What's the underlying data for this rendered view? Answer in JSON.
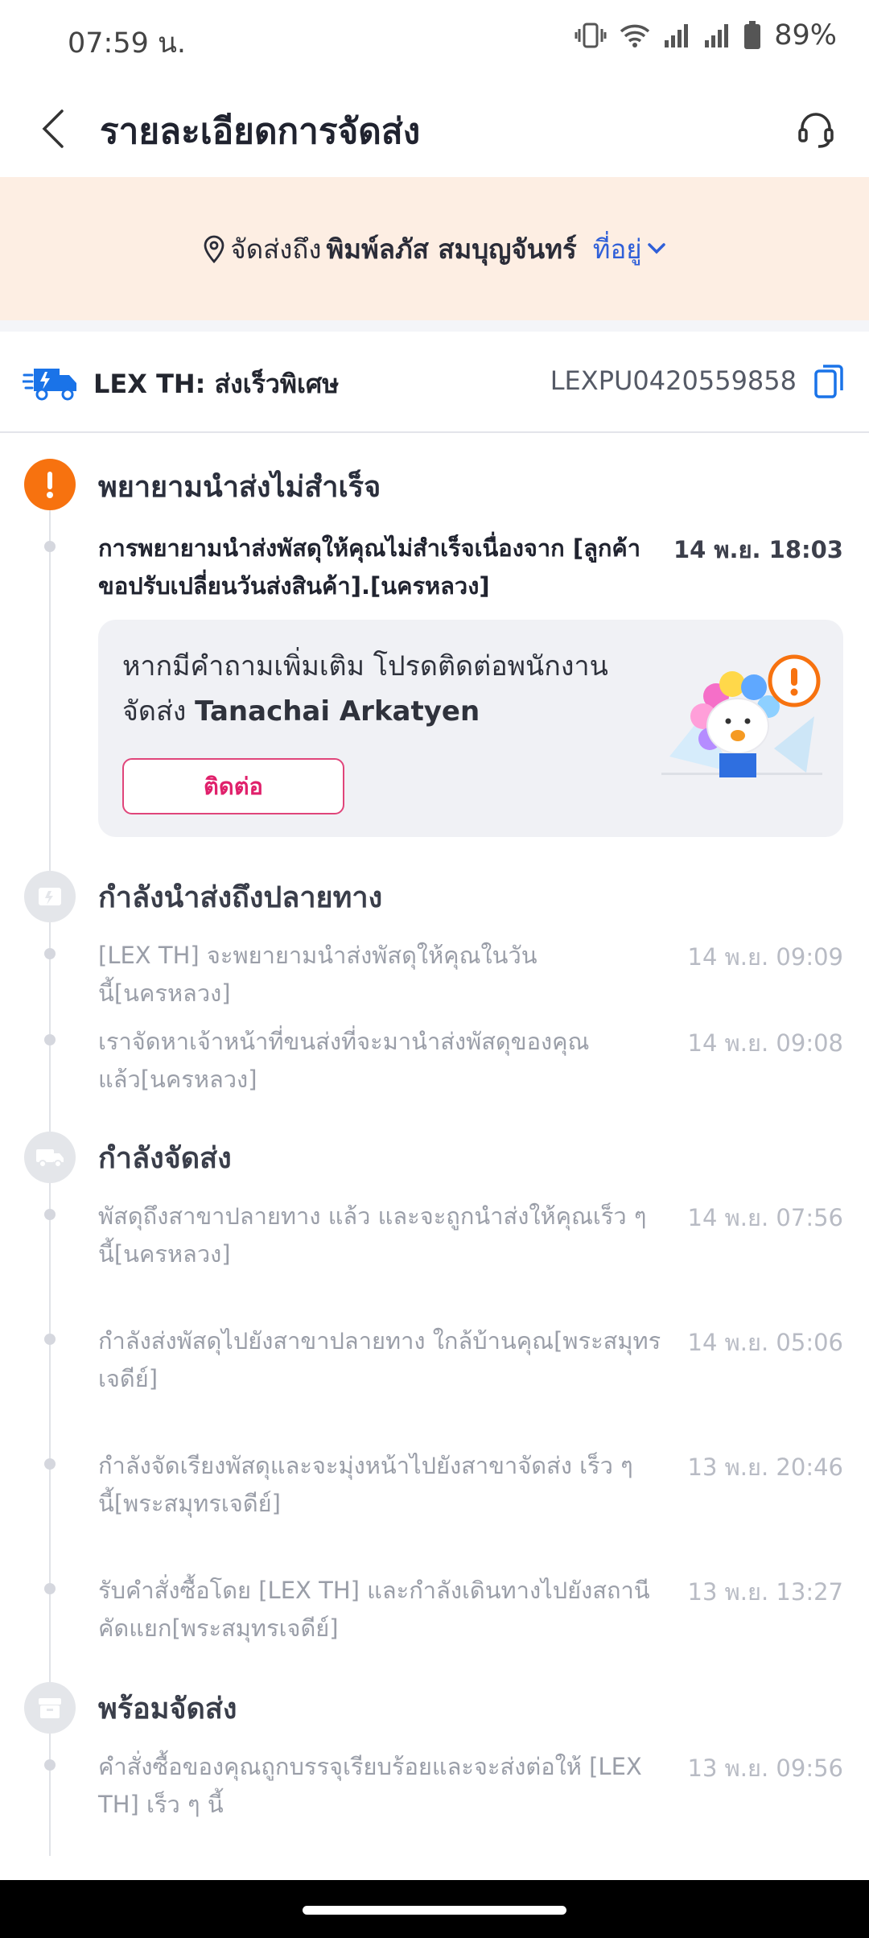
{
  "status_bar": {
    "time": "07:59 น.",
    "battery": "89%"
  },
  "header": {
    "title": "รายละเอียดการจัดส่ง"
  },
  "address": {
    "prefix": "จัดส่งถึง",
    "name": "พิมพ์ลภัส สมบุญจันทร์",
    "link_label": "ที่อยู่"
  },
  "carrier": {
    "name": "LEX TH: ส่งเร็วพิเศษ",
    "tracking_number": "LEXPU0420559858"
  },
  "stages": [
    {
      "title": "พยายามนำส่งไม่สำเร็จ",
      "icon": "alert-icon",
      "events": [
        {
          "text": "การพยายามนำส่งพัสดุให้คุณไม่สำเร็จเนื่องจาก [ลูกค้าขอปรับเปลี่ยนวันส่งสินค้า].[นครหลวง]",
          "time": "14 พ.ย. 18:03"
        }
      ],
      "contact_card": {
        "text": "หากมีคำถามเพิ่มเติม โปรดติดต่อพนักงานจัดส่ง",
        "courier_name": "Tanachai Arkatyen",
        "button_label": "ติดต่อ"
      }
    },
    {
      "title": "กำลังนำส่งถึงปลายทาง",
      "icon": "parcel-icon",
      "events": [
        {
          "text": "[LEX TH] จะพยายามนำส่งพัสดุให้คุณในวันนี้[นครหลวง]",
          "time": "14 พ.ย. 09:09"
        },
        {
          "text": "เราจัดหาเจ้าหน้าที่ขนส่งที่จะมานำส่งพัสดุของคุณแล้ว[นครหลวง]",
          "time": "14 พ.ย. 09:08"
        }
      ]
    },
    {
      "title": "กำลังจัดส่ง",
      "icon": "truck-icon",
      "events": [
        {
          "text": "พัสดุถึงสาขาปลายทาง แล้ว และจะถูกนำส่งให้คุณเร็ว ๆ นี้[นครหลวง]",
          "time": "14 พ.ย. 07:56"
        },
        {
          "text": "กำลังส่งพัสดุไปยังสาขาปลายทาง ใกล้บ้านคุณ[พระสมุทรเจดีย์]",
          "time": "14 พ.ย. 05:06"
        },
        {
          "text": "กำลังจัดเรียงพัสดุและจะมุ่งหน้าไปยังสาขาจัดส่ง เร็ว ๆ นี้[พระสมุทรเจดีย์]",
          "time": "13 พ.ย. 20:46"
        },
        {
          "text": "รับคำสั่งซื้อโดย [LEX TH] และกำลังเดินทางไปยังสถานีคัดแยก[พระสมุทรเจดีย์]",
          "time": "13 พ.ย. 13:27"
        }
      ]
    },
    {
      "title": "พร้อมจัดส่ง",
      "icon": "box-icon",
      "events": [
        {
          "text": "คำสั่งซื้อของคุณถูกบรรจุเรียบร้อยและจะส่งต่อให้ [LEX TH] เร็ว ๆ นี้",
          "time": "13 พ.ย. 09:56"
        }
      ]
    }
  ],
  "colors": {
    "accent_orange": "#f7720f",
    "banner_bg": "#fdeee3",
    "link_blue": "#2f5fd8",
    "contact_pink": "#e0206b",
    "carrier_blue": "#1a73e8"
  }
}
